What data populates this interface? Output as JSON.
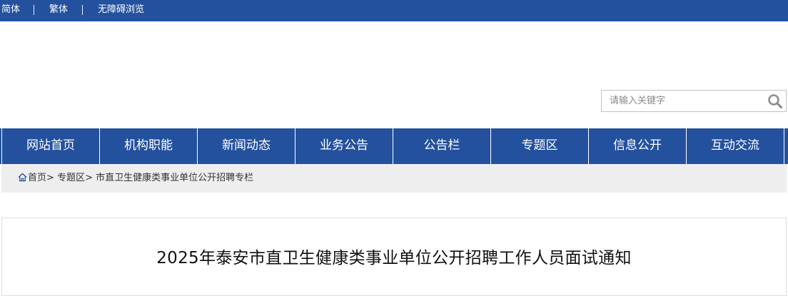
{
  "topbar": {
    "simplified": "简体",
    "traditional": "繁体",
    "accessible": "无障碍浏览",
    "separator": "|"
  },
  "search": {
    "placeholder": "请输入关键字",
    "value": "",
    "icon": "magnifier-icon"
  },
  "nav": {
    "items": [
      {
        "label": "网站首页"
      },
      {
        "label": "机构职能"
      },
      {
        "label": "新闻动态"
      },
      {
        "label": "业务公告"
      },
      {
        "label": "公告栏"
      },
      {
        "label": "专题区"
      },
      {
        "label": "信息公开"
      },
      {
        "label": "互动交流"
      }
    ]
  },
  "breadcrumb": {
    "home_icon": "home-icon",
    "home": "首页",
    "sep1": ">",
    "section": "专题区",
    "sep2": ">",
    "current": "市直卫生健康类事业单位公开招聘专栏"
  },
  "article": {
    "title": "2025年泰安市直卫生健康类事业单位公开招聘工作人员面试通知"
  },
  "colors": {
    "brand_blue": "#24519e",
    "breadcrumb_bg": "#eeeeee"
  }
}
